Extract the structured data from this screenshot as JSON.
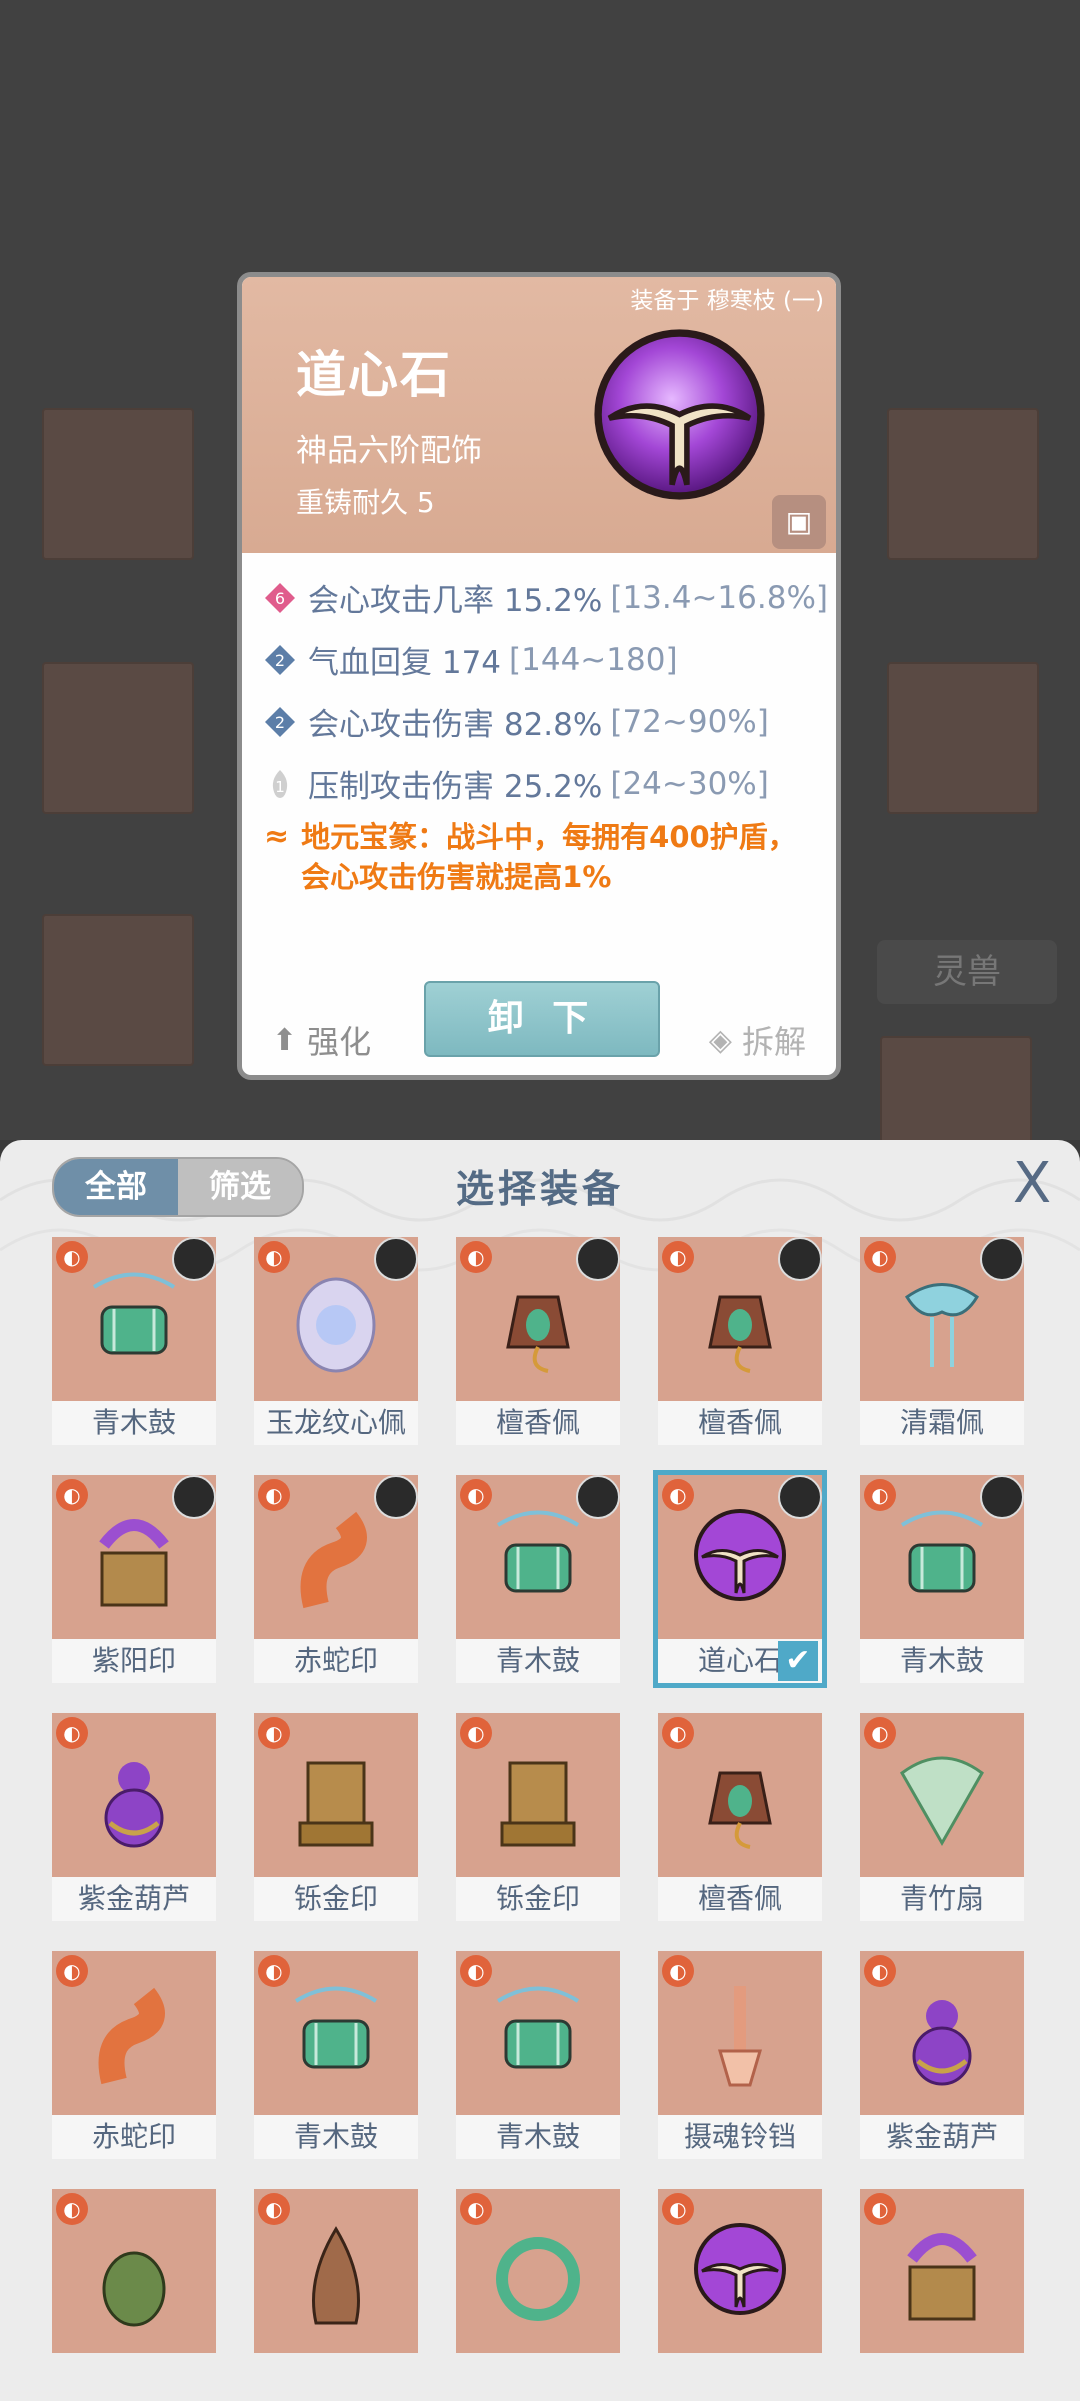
{
  "background": {
    "side_button": "灵兽"
  },
  "detail": {
    "equipped_on": "装备于 穆寒枝 (一)",
    "name": "道心石",
    "grade": "神品六阶配饰",
    "durability": "重铸耐久 5",
    "stats": [
      {
        "level": "6",
        "label": "会心攻击几率 15.2%",
        "range": "[13.4~16.8%]",
        "badge_color": "#e05c8c"
      },
      {
        "level": "2",
        "label": "气血回复 174",
        "range": "[144~180]",
        "badge_color": "#5c7ea8"
      },
      {
        "level": "2",
        "label": "会心攻击伤害 82.8%",
        "range": "[72~90%]",
        "badge_color": "#5c7ea8"
      },
      {
        "level": "1",
        "label": "压制攻击伤害 25.2%",
        "range": "[24~30%]",
        "badge_color": "#c8c8c8"
      }
    ],
    "skill_text": "地元宝篆：战斗中，每拥有400护盾，会心攻击伤害就提高1%",
    "unequip_label": "卸 下",
    "strengthen_label": "强化",
    "dismantle_label": "拆解"
  },
  "panel": {
    "tab_all": "全部",
    "tab_filter": "筛选",
    "title": "选择装备",
    "close": "X"
  },
  "items": [
    {
      "name": "青木鼓",
      "kind": "drum",
      "avatar": true
    },
    {
      "name": "玉龙纹心佩",
      "kind": "pendant-silver",
      "avatar": true
    },
    {
      "name": "檀香佩",
      "kind": "bell",
      "avatar": true
    },
    {
      "name": "檀香佩",
      "kind": "bell",
      "avatar": true
    },
    {
      "name": "清霜佩",
      "kind": "frost",
      "avatar": true
    },
    {
      "name": "紫阳印",
      "kind": "seal-purple",
      "avatar": true
    },
    {
      "name": "赤蛇印",
      "kind": "snake",
      "avatar": true
    },
    {
      "name": "青木鼓",
      "kind": "drum",
      "avatar": true
    },
    {
      "name": "道心石",
      "kind": "orb",
      "avatar": true,
      "selected": true
    },
    {
      "name": "青木鼓",
      "kind": "drum",
      "avatar": true
    },
    {
      "name": "紫金葫芦",
      "kind": "gourd",
      "avatar": false
    },
    {
      "name": "铄金印",
      "kind": "gold-seal",
      "avatar": false
    },
    {
      "name": "铄金印",
      "kind": "gold-seal",
      "avatar": false
    },
    {
      "name": "檀香佩",
      "kind": "bell",
      "avatar": false
    },
    {
      "name": "青竹扇",
      "kind": "fan",
      "avatar": false
    },
    {
      "name": "赤蛇印",
      "kind": "snake",
      "avatar": false
    },
    {
      "name": "青木鼓",
      "kind": "drum",
      "avatar": false
    },
    {
      "name": "青木鼓",
      "kind": "drum",
      "avatar": false
    },
    {
      "name": "摄魂铃铛",
      "kind": "bellrod",
      "avatar": false
    },
    {
      "name": "紫金葫芦",
      "kind": "gourd",
      "avatar": false
    },
    {
      "name": "",
      "kind": "beetle",
      "avatar": false
    },
    {
      "name": "",
      "kind": "shell",
      "avatar": false
    },
    {
      "name": "",
      "kind": "jade-ring",
      "avatar": false
    },
    {
      "name": "",
      "kind": "orb",
      "avatar": false
    },
    {
      "name": "",
      "kind": "seal-purple",
      "avatar": false
    }
  ]
}
